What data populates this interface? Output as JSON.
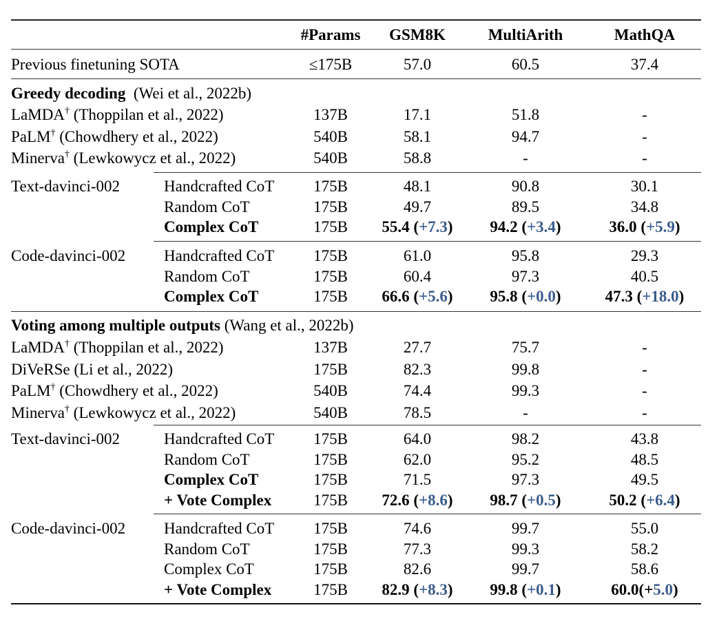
{
  "table": {
    "headers": {
      "params": "#Params",
      "gsm8k": "GSM8K",
      "multiarith": "MultiArith",
      "mathqa": "MathQA"
    },
    "sota": {
      "model": "Previous finetuning SOTA",
      "params": "≤175B",
      "gsm8k": "57.0",
      "multiarith": "60.5",
      "mathqa": "37.4"
    },
    "greedy": {
      "title_bold": "Greedy decoding",
      "title_cite": "(Wei et al., 2022b)",
      "baselines": [
        {
          "name": "LaMDA",
          "dagger": "†",
          "cite": "(Thoppilan et al., 2022)",
          "params": "137B",
          "gsm8k": "17.1",
          "multiarith": "51.8",
          "mathqa": "-"
        },
        {
          "name": "PaLM",
          "dagger": "†",
          "cite": "(Chowdhery et al., 2022)",
          "params": "540B",
          "gsm8k": "58.1",
          "multiarith": "94.7",
          "mathqa": "-"
        },
        {
          "name": "Minerva",
          "dagger": "†",
          "cite": "(Lewkowycz et al., 2022)",
          "params": "540B",
          "gsm8k": "58.8",
          "multiarith": "-",
          "mathqa": "-"
        }
      ],
      "text_davinci": {
        "model": "Text-davinci-002",
        "rows": [
          {
            "method": "Handcrafted CoT",
            "params": "175B",
            "gsm8k": "48.1",
            "multiarith": "90.8",
            "mathqa": "30.1"
          },
          {
            "method": "Random CoT",
            "params": "175B",
            "gsm8k": "49.7",
            "multiarith": "89.5",
            "mathqa": "34.8"
          },
          {
            "method": "Complex CoT",
            "params": "175B",
            "gsm8k": "55.4",
            "gsm8k_gain": "+7.3",
            "multiarith": "94.2",
            "multiarith_gain": "+3.4",
            "mathqa": "36.0",
            "mathqa_gain": "+5.9"
          }
        ]
      },
      "code_davinci": {
        "model": "Code-davinci-002",
        "rows": [
          {
            "method": "Handcrafted CoT",
            "params": "175B",
            "gsm8k": "61.0",
            "multiarith": "95.8",
            "mathqa": "29.3"
          },
          {
            "method": "Random CoT",
            "params": "175B",
            "gsm8k": "60.4",
            "multiarith": "97.3",
            "mathqa": "40.5"
          },
          {
            "method": "Complex CoT",
            "params": "175B",
            "gsm8k": "66.6",
            "gsm8k_gain": "+5.6",
            "multiarith": "95.8",
            "multiarith_gain": "+0.0",
            "mathqa": "47.3",
            "mathqa_gain": "+18.0"
          }
        ]
      }
    },
    "voting": {
      "title_bold": "Voting among multiple outputs",
      "title_cite": "(Wang et al., 2022b)",
      "baselines": [
        {
          "name": "LaMDA",
          "dagger": "†",
          "cite": "(Thoppilan et al., 2022)",
          "params": "137B",
          "gsm8k": "27.7",
          "multiarith": "75.7",
          "mathqa": "-"
        },
        {
          "name": "DiVeRSe",
          "dagger": "",
          "cite": "(Li et al., 2022)",
          "params": "175B",
          "gsm8k": "82.3",
          "multiarith": "99.8",
          "mathqa": "-"
        },
        {
          "name": "PaLM",
          "dagger": "†",
          "cite": "(Chowdhery et al., 2022)",
          "params": "540B",
          "gsm8k": "74.4",
          "multiarith": "99.3",
          "mathqa": "-"
        },
        {
          "name": "Minerva",
          "dagger": "†",
          "cite": "(Lewkowycz et al., 2022)",
          "params": "540B",
          "gsm8k": "78.5",
          "multiarith": "-",
          "mathqa": "-"
        }
      ],
      "text_davinci": {
        "model": "Text-davinci-002",
        "rows": [
          {
            "method": "Handcrafted CoT",
            "params": "175B",
            "gsm8k": "64.0",
            "multiarith": "98.2",
            "mathqa": "43.8"
          },
          {
            "method": "Random CoT",
            "params": "175B",
            "gsm8k": "62.0",
            "multiarith": "95.2",
            "mathqa": "48.5"
          },
          {
            "method": "Complex CoT",
            "params": "175B",
            "gsm8k": "71.5",
            "multiarith": "97.3",
            "mathqa": "49.5"
          },
          {
            "method": "+ Vote Complex",
            "params": "175B",
            "gsm8k": "72.6",
            "gsm8k_gain": "+8.6",
            "multiarith": "98.7",
            "multiarith_gain": "+0.5",
            "mathqa": "50.2",
            "mathqa_gain": "+6.4"
          }
        ]
      },
      "code_davinci": {
        "model": "Code-davinci-002",
        "rows": [
          {
            "method": "Handcrafted CoT",
            "params": "175B",
            "gsm8k": "74.6",
            "multiarith": "99.7",
            "mathqa": "55.0"
          },
          {
            "method": "Random CoT",
            "params": "175B",
            "gsm8k": "77.3",
            "multiarith": "99.3",
            "mathqa": "58.2"
          },
          {
            "method": "Complex CoT",
            "params": "175B",
            "gsm8k": "82.6",
            "multiarith": "99.7",
            "mathqa": "58.6"
          },
          {
            "method": "+ Vote Complex",
            "params": "175B",
            "gsm8k": "82.9",
            "gsm8k_gain": "+8.3",
            "multiarith": "99.8",
            "multiarith_gain": "+0.1",
            "mathqa": "60.0",
            "mathqa_plus": "+",
            "mathqa_gain_tail": "5.0"
          }
        ]
      }
    }
  }
}
